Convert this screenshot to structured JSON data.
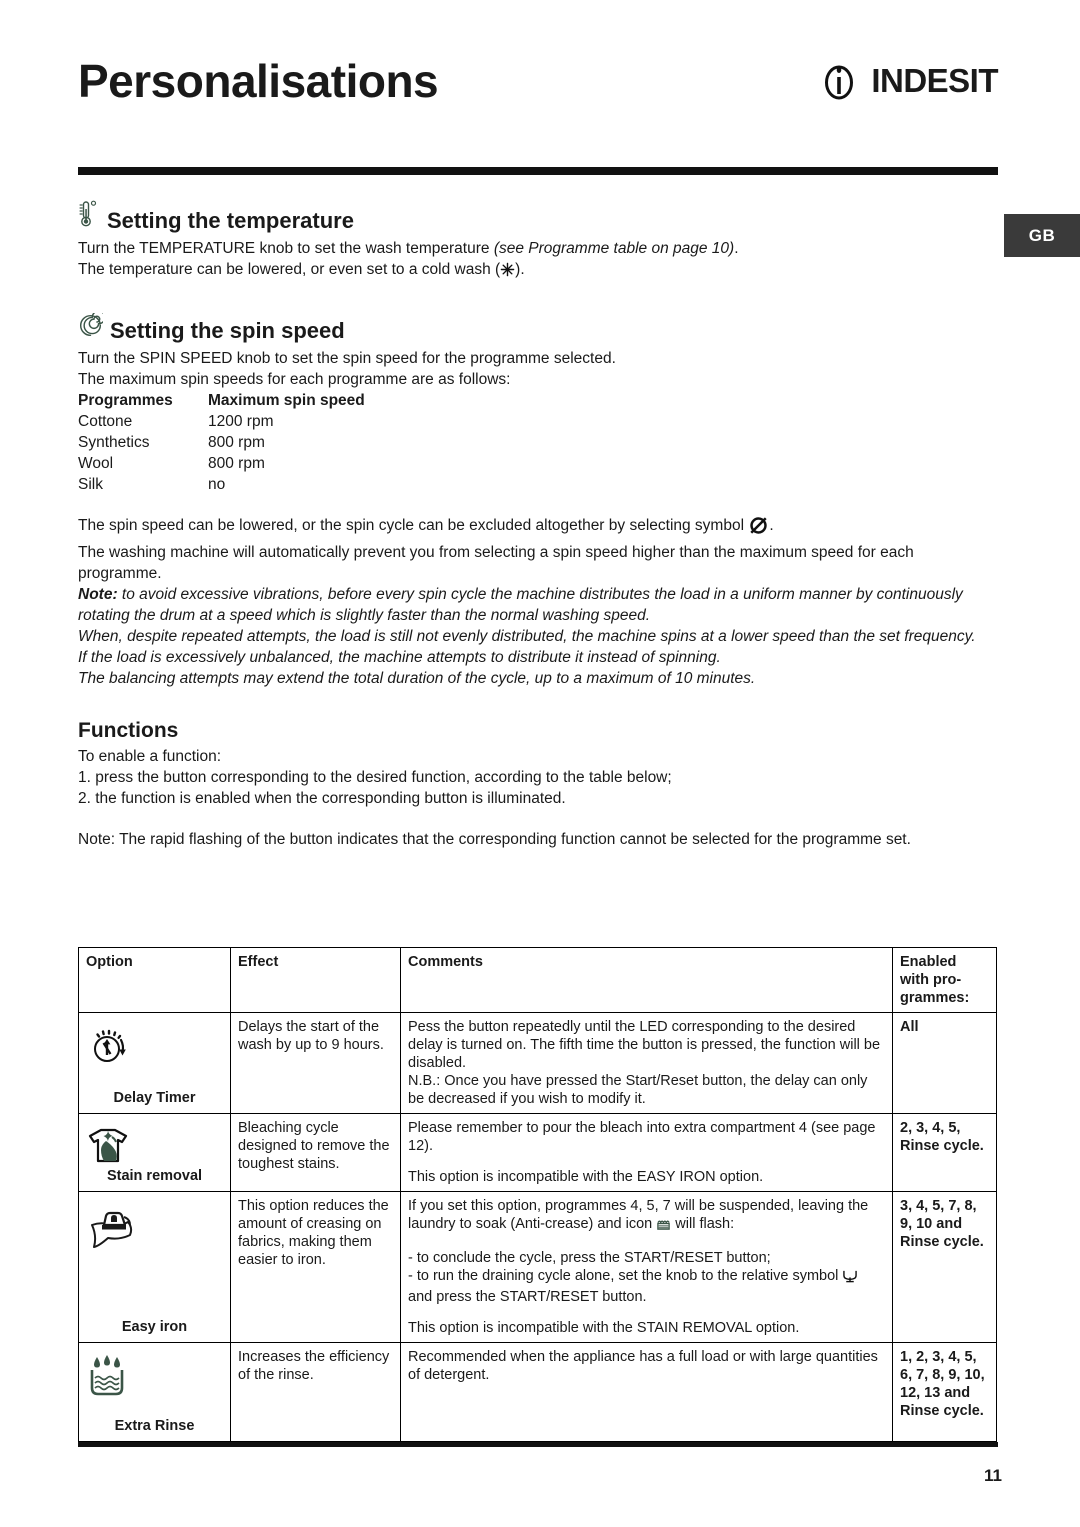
{
  "header": {
    "title": "Personalisations",
    "brand": "INDESIT",
    "locale_badge": "GB"
  },
  "temperature": {
    "icon": "thermometer-icon",
    "heading": "Setting the temperature",
    "line1_a": "Turn the TEMPERATURE knob to set the wash temperature ",
    "line1_b": "(see Programme table on page 10)",
    "line1_c": ".",
    "line2_a": "The temperature can be lowered, or even set to a cold wash (",
    "line2_b": ").",
    "cold_icon": "snowflake-icon"
  },
  "spin": {
    "icon": "spiral-icon",
    "heading": "Setting the spin speed",
    "line1": "Turn the SPIN SPEED knob to set the spin speed for the programme selected.",
    "line2": "The maximum spin speeds for each programme are as follows:",
    "table": {
      "headers": [
        "Programmes",
        "Maximum spin speed"
      ],
      "rows": [
        [
          "Cottone",
          "1200 rpm"
        ],
        [
          "Synthetics",
          "800 rpm"
        ],
        [
          "Wool",
          "800 rpm"
        ],
        [
          "Silk",
          "no"
        ]
      ]
    },
    "para1_a": "The spin speed can be lowered, or the spin cycle can be excluded altogether by selecting symbol ",
    "para1_b": ".",
    "no_spin_icon": "no-spin-icon",
    "para2": "The washing machine will automatically prevent you from selecting a spin speed higher than the maximum speed for each programme.",
    "note_label": "Note:",
    "note_text": " to avoid excessive vibrations, before every spin cycle the machine distributes the load in a uniform manner by continuously rotating the drum at a speed which is slightly faster than the normal washing speed.",
    "note_line2": "When, despite repeated attempts, the load is still not evenly distributed, the machine spins at a lower speed than the set frequency.",
    "note_line3": "If the load is excessively unbalanced, the machine attempts to distribute it instead of spinning.",
    "note_line4": "The balancing attempts may extend the total duration of the cycle, up to a maximum of 10 minutes."
  },
  "functions": {
    "heading": "Functions",
    "intro": "To enable a function:",
    "step1": "1. press the button corresponding to the desired function, according to the table below;",
    "step2": "2. the function is enabled when the corresponding button is illuminated.",
    "note": "Note: The rapid flashing of the button indicates that the corresponding function cannot be selected for the programme set."
  },
  "options_table": {
    "headers": {
      "option": "Option",
      "effect": "Effect",
      "comments": "Comments",
      "enabled": "Enabled with pro-grammes:"
    },
    "rows": [
      {
        "icon": "delay-timer-icon",
        "label": "Delay Timer",
        "effect": "Delays the start of the wash by up to 9 hours.",
        "comment1": "Pess the button repeatedly until the LED corresponding to the desired delay is turned on. The fifth time the button is pressed, the function will be disabled.",
        "comment2": "N.B.: Once you have pressed the Start/Reset button, the delay can only be decreased if you wish to modify it.",
        "enabled": "All"
      },
      {
        "icon": "stain-removal-icon",
        "label": "Stain removal",
        "effect": "Bleaching cycle designed to remove the toughest stains.",
        "comment1": "Please remember to pour the bleach into extra compartment 4 (see page 12).",
        "comment2": " This option is incompatible with the EASY IRON option.",
        "enabled": "2, 3, 4, 5, Rinse cycle."
      },
      {
        "icon": "easy-iron-icon",
        "label": "Easy iron",
        "effect": "This option reduces the amount of creasing on fabrics, making them easier to iron.",
        "comment1_a": "If you set this option, programmes 4, 5, 7 will be suspended, leaving the laundry to soak (Anti-crease) and icon ",
        "comment1_b": " will flash:",
        "comment_bullet1": "- to conclude the cycle, press the START/RESET button;",
        "comment_bullet2_a": "- to run the draining cycle alone, set the knob to the relative symbol ",
        "comment_bullet2_b": " and press the START/RESET button.",
        "comment2": " This option is incompatible with the STAIN REMOVAL option.",
        "enabled": "3, 4, 5, 7, 8, 9, 10 and Rinse cycle."
      },
      {
        "icon": "extra-rinse-icon",
        "label": "Extra Rinse",
        "effect": "Increases the efficiency of the rinse.",
        "comment1": "Recommended when the appliance has a full load or with large quantities of detergent.",
        "comment2": "",
        "enabled": "1, 2, 3, 4, 5, 6, 7, 8, 9, 10, 12, 13 and Rinse cycle."
      }
    ]
  },
  "footer": {
    "page_number": "11"
  },
  "colors": {
    "ink": "#1a1a1a",
    "rule": "#111111",
    "badge_bg": "#3a3a3a",
    "icon_green": "#3b5547"
  }
}
